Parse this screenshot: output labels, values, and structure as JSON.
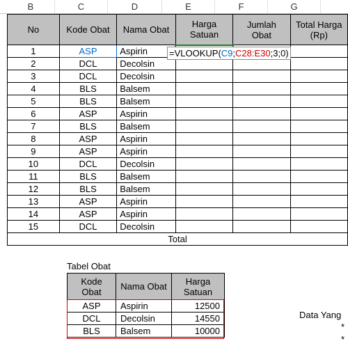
{
  "columns": [
    "B",
    "C",
    "D",
    "E",
    "F",
    "G"
  ],
  "headers": {
    "no": "No",
    "kode": "Kode Obat",
    "nama": "Nama Obat",
    "harga": "Harga Satuan",
    "jumlah": "Jumlah Obat",
    "total": "Total Harga (Rp)"
  },
  "rows": [
    {
      "no": "1",
      "kode": "ASP",
      "nama": "Aspirin"
    },
    {
      "no": "2",
      "kode": "DCL",
      "nama": "Decolsin"
    },
    {
      "no": "3",
      "kode": "DCL",
      "nama": "Decolsin"
    },
    {
      "no": "4",
      "kode": "BLS",
      "nama": "Balsem"
    },
    {
      "no": "5",
      "kode": "BLS",
      "nama": "Balsem"
    },
    {
      "no": "6",
      "kode": "ASP",
      "nama": "Aspirin"
    },
    {
      "no": "7",
      "kode": "BLS",
      "nama": "Balsem"
    },
    {
      "no": "8",
      "kode": "ASP",
      "nama": "Aspirin"
    },
    {
      "no": "9",
      "kode": "ASP",
      "nama": "Aspirin"
    },
    {
      "no": "10",
      "kode": "DCL",
      "nama": "Decolsin"
    },
    {
      "no": "11",
      "kode": "BLS",
      "nama": "Balsem"
    },
    {
      "no": "12",
      "kode": "BLS",
      "nama": "Balsem"
    },
    {
      "no": "13",
      "kode": "ASP",
      "nama": "Aspirin"
    },
    {
      "no": "14",
      "kode": "ASP",
      "nama": "Aspirin"
    },
    {
      "no": "15",
      "kode": "DCL",
      "nama": "Decolsin"
    }
  ],
  "total_label": "Total",
  "formula": {
    "prefix": "=VLOOKUP(",
    "arg1": "C9",
    "sep1": ";",
    "arg2": "C28:E30",
    "sep2": ";3;0)"
  },
  "lookup_label": "Tabel Obat",
  "lookup_headers": {
    "kode": "Kode Obat",
    "nama": "Nama Obat",
    "harga": "Harga Satuan"
  },
  "lookup_rows": [
    {
      "kode": "ASP",
      "nama": "Aspirin",
      "harga": "12500"
    },
    {
      "kode": "DCL",
      "nama": "Decolsin",
      "harga": "14550"
    },
    {
      "kode": "BLS",
      "nama": "Balsem",
      "harga": "10000"
    }
  ],
  "side": {
    "line1": "Data Yang",
    "line2": "*",
    "line3": "*"
  }
}
